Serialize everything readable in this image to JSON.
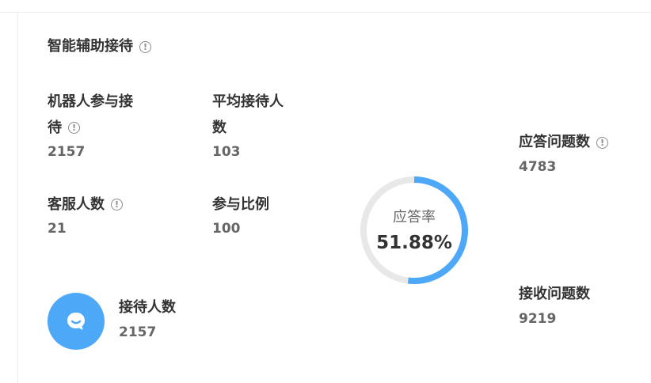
{
  "card": {
    "title": "智能辅助接待"
  },
  "stats": {
    "robot_reception": {
      "label_line1": "机器人参与接",
      "label_line2": "待",
      "value": "2157"
    },
    "avg_reception": {
      "label_line1": "平均接待人",
      "label_line2": "数",
      "value": "103"
    },
    "cs_count": {
      "label": "客服人数",
      "value": "21"
    },
    "participation_ratio": {
      "label": "参与比例",
      "value": "100"
    }
  },
  "reception": {
    "label": "接待人数",
    "value": "2157",
    "icon": "chat-bubble-icon"
  },
  "answer_rate": {
    "label": "应答率",
    "value": "51.88%",
    "fraction": 0.5188
  },
  "answered": {
    "label": "应答问题数",
    "value": "4783"
  },
  "received": {
    "label": "接收问题数",
    "value": "9219"
  },
  "colors": {
    "accent": "#4da8f7",
    "track": "#e8e8e8"
  }
}
